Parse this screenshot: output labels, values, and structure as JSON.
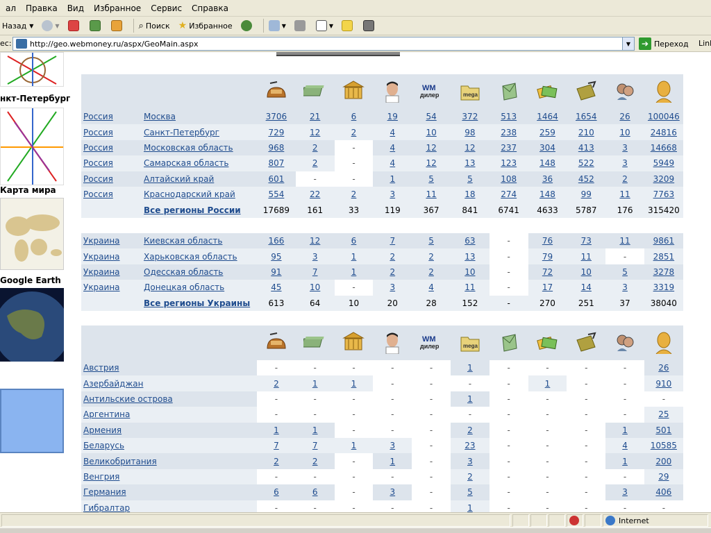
{
  "menu": [
    "ал",
    "Правка",
    "Вид",
    "Избранное",
    "Сервис",
    "Справка"
  ],
  "toolbar": {
    "back_label": "Назад",
    "search_label": "Поиск",
    "favorites_label": "Избранное"
  },
  "address": {
    "label": "ес:",
    "url": "http://geo.webmoney.ru/aspx/GeoMain.aspx",
    "go_label": "Переход",
    "links_label": "Link"
  },
  "sidebar": {
    "spb_label": "нкт-Петербург",
    "world_label": "Карта мира",
    "earth_label": "Google Earth"
  },
  "columns": [
    "wallet-icon",
    "money-stack-icon",
    "bank-icon",
    "person-icon",
    "wm-dealer-icon",
    "mega-stock-icon",
    "envelope-icon",
    "cards-icon",
    "transfer-icon",
    "people-icon",
    "user-head-icon"
  ],
  "header_texts": {
    "wm_dealer": "WM дилер",
    "mega_stock": "mega stock"
  },
  "russia": {
    "rows": [
      {
        "country": "Россия",
        "region": "Москва",
        "values": [
          "3706",
          "21",
          "6",
          "19",
          "54",
          "372",
          "513",
          "1464",
          "1654",
          "26",
          "100046"
        ]
      },
      {
        "country": "Россия",
        "region": "Санкт-Петербург",
        "values": [
          "729",
          "12",
          "2",
          "4",
          "10",
          "98",
          "238",
          "259",
          "210",
          "10",
          "24816"
        ]
      },
      {
        "country": "Россия",
        "region": "Московская область",
        "values": [
          "968",
          "2",
          "-",
          "4",
          "12",
          "12",
          "237",
          "304",
          "413",
          "3",
          "14668"
        ]
      },
      {
        "country": "Россия",
        "region": "Самарская область",
        "values": [
          "807",
          "2",
          "-",
          "4",
          "12",
          "13",
          "123",
          "148",
          "522",
          "3",
          "5949"
        ]
      },
      {
        "country": "Россия",
        "region": "Алтайский край",
        "values": [
          "601",
          "-",
          "-",
          "1",
          "5",
          "5",
          "108",
          "36",
          "452",
          "2",
          "3209"
        ]
      },
      {
        "country": "Россия",
        "region": "Краснодарский край",
        "values": [
          "554",
          "22",
          "2",
          "3",
          "11",
          "18",
          "274",
          "148",
          "99",
          "11",
          "7763"
        ]
      }
    ],
    "total": {
      "label": "Все регионы России",
      "values": [
        "17689",
        "161",
        "33",
        "119",
        "367",
        "841",
        "6741",
        "4633",
        "5787",
        "176",
        "315420"
      ]
    }
  },
  "ukraine": {
    "rows": [
      {
        "country": "Украина",
        "region": "Киевская область",
        "values": [
          "166",
          "12",
          "6",
          "7",
          "5",
          "63",
          "-",
          "76",
          "73",
          "11",
          "9861"
        ]
      },
      {
        "country": "Украина",
        "region": "Харьковская область",
        "values": [
          "95",
          "3",
          "1",
          "2",
          "2",
          "13",
          "-",
          "79",
          "11",
          "-",
          "2851"
        ]
      },
      {
        "country": "Украина",
        "region": "Одесская область",
        "values": [
          "91",
          "7",
          "1",
          "2",
          "2",
          "10",
          "-",
          "72",
          "10",
          "5",
          "3278"
        ]
      },
      {
        "country": "Украина",
        "region": "Донецкая область",
        "values": [
          "45",
          "10",
          "-",
          "3",
          "4",
          "11",
          "-",
          "17",
          "14",
          "3",
          "3319"
        ]
      }
    ],
    "total": {
      "label": "Все регионы Украины",
      "values": [
        "613",
        "64",
        "10",
        "20",
        "28",
        "152",
        "-",
        "270",
        "251",
        "37",
        "38040"
      ]
    }
  },
  "world": {
    "rows": [
      {
        "country": "Австрия",
        "values": [
          "-",
          "-",
          "-",
          "-",
          "-",
          "1",
          "-",
          "-",
          "-",
          "-",
          "26"
        ]
      },
      {
        "country": "Азербайджан",
        "values": [
          "2",
          "1",
          "1",
          "-",
          "-",
          "-",
          "-",
          "1",
          "-",
          "-",
          "910"
        ]
      },
      {
        "country": "Антильские острова",
        "values": [
          "-",
          "-",
          "-",
          "-",
          "-",
          "1",
          "-",
          "-",
          "-",
          "-",
          "-"
        ]
      },
      {
        "country": "Аргентина",
        "values": [
          "-",
          "-",
          "-",
          "-",
          "-",
          "-",
          "-",
          "-",
          "-",
          "-",
          "25"
        ]
      },
      {
        "country": "Армения",
        "values": [
          "1",
          "1",
          "-",
          "-",
          "-",
          "2",
          "-",
          "-",
          "-",
          "1",
          "501"
        ]
      },
      {
        "country": "Беларусь",
        "values": [
          "7",
          "7",
          "1",
          "3",
          "-",
          "23",
          "-",
          "-",
          "-",
          "4",
          "10585"
        ]
      },
      {
        "country": "Великобритания",
        "values": [
          "2",
          "2",
          "-",
          "1",
          "-",
          "3",
          "-",
          "-",
          "-",
          "1",
          "200"
        ]
      },
      {
        "country": "Венгрия",
        "values": [
          "-",
          "-",
          "-",
          "-",
          "-",
          "2",
          "-",
          "-",
          "-",
          "-",
          "29"
        ]
      },
      {
        "country": "Германия",
        "values": [
          "6",
          "6",
          "-",
          "3",
          "-",
          "5",
          "-",
          "-",
          "-",
          "3",
          "406"
        ]
      },
      {
        "country": "Гибралтар",
        "values": [
          "-",
          "-",
          "-",
          "-",
          "-",
          "1",
          "-",
          "-",
          "-",
          "-",
          "-"
        ]
      }
    ]
  },
  "status": {
    "zone": "Internet"
  }
}
